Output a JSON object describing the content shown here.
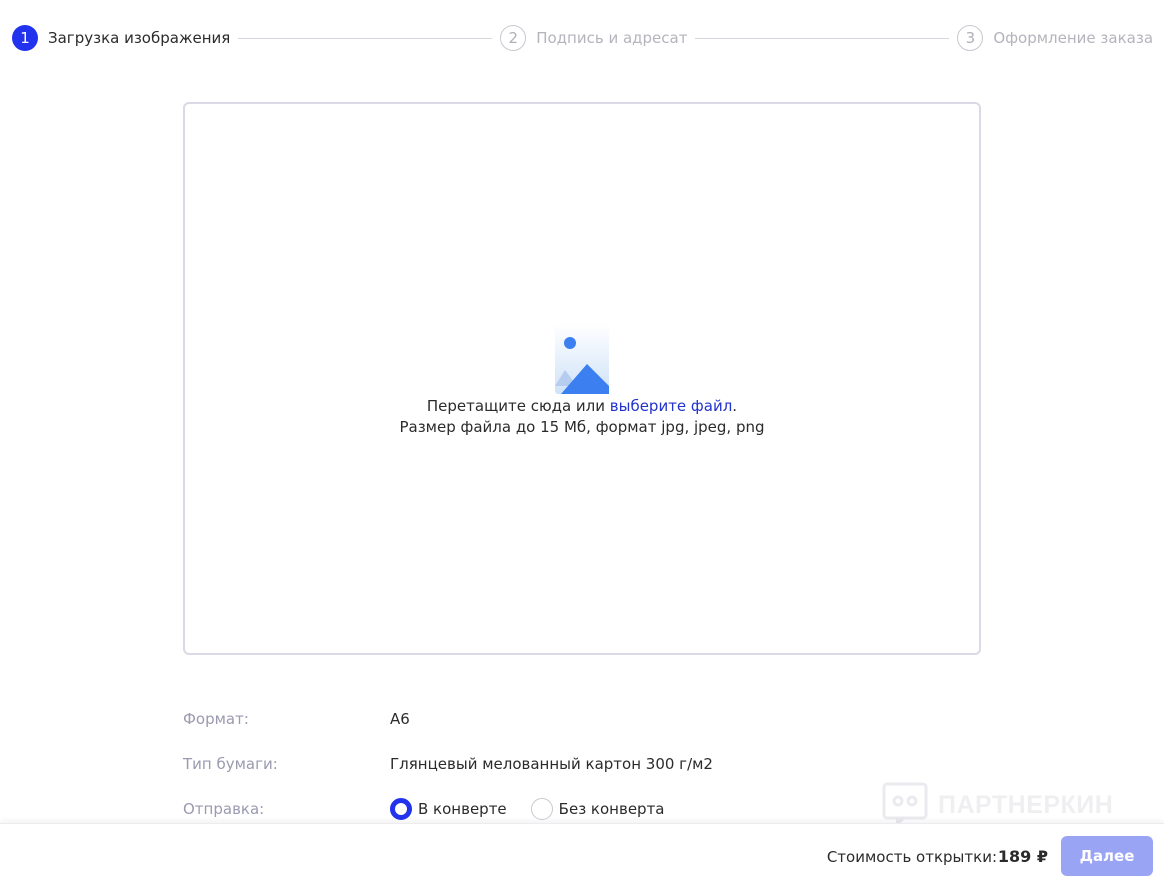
{
  "stepper": {
    "steps": [
      {
        "number": "1",
        "label": "Загрузка изображения",
        "state": "active"
      },
      {
        "number": "2",
        "label": "Подпись и адресат",
        "state": "inactive"
      },
      {
        "number": "3",
        "label": "Оформление заказа",
        "state": "inactive"
      }
    ]
  },
  "upload": {
    "icon": "image-icon",
    "drag_text": "Перетащите сюда или ",
    "choose_link": "выберите файл",
    "after_link": ".",
    "size_hint": "Размер файла до 15 Мб, формат jpg, jpeg, png"
  },
  "details": {
    "format_label": "Формат:",
    "format_value": "А6",
    "paper_label": "Тип бумаги:",
    "paper_value": "Глянцевый мелованный картон 300 г/м2",
    "delivery_label": "Отправка:",
    "delivery_options": [
      {
        "label": "В конверте",
        "checked": true
      },
      {
        "label": "Без конверта",
        "checked": false
      }
    ]
  },
  "watermark": {
    "text": "ПАРТНЕРКИН",
    "icon": "partnerkin-logo-icon"
  },
  "footer": {
    "price_label": "Стоимость открытки:",
    "price_value": "189 ₽",
    "next_button": "Далее"
  },
  "colors": {
    "accent": "#2233ee",
    "link": "#2233cc",
    "button_disabled": "#9aa4f5",
    "muted": "#9a9ab0"
  }
}
